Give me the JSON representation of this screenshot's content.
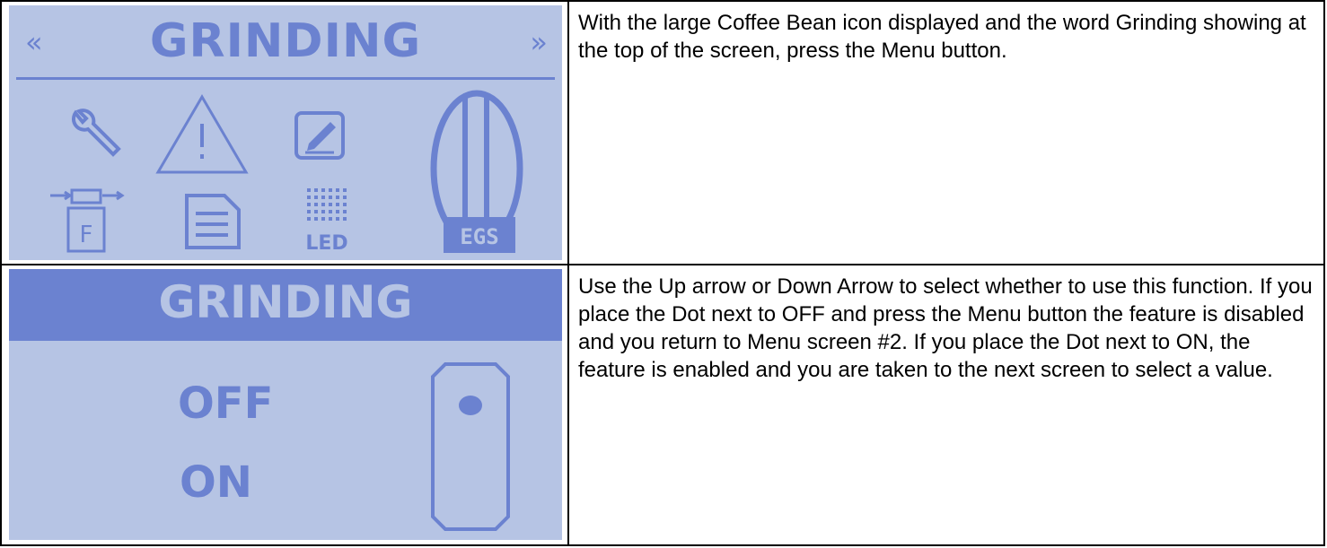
{
  "rows": [
    {
      "screen": {
        "title": "GRINDING",
        "nav_left": "«",
        "nav_right": "»",
        "icons": [
          "wrench-icon",
          "warning-icon",
          "edit-icon",
          "coffee-bean-icon",
          "filter-icon",
          "document-icon",
          "led-icon",
          "egs-icon"
        ],
        "led_label": "LED",
        "egs_label": "EGS",
        "filter_label": "F"
      },
      "text": "With the large Coffee Bean icon displayed and the word Grinding showing at the top of the screen, press the Menu button."
    },
    {
      "screen": {
        "title": "GRINDING",
        "options": [
          "OFF",
          "ON"
        ],
        "selected": "OFF",
        "icons": [
          "toggle-selector-icon"
        ]
      },
      "text": "Use the Up arrow or Down Arrow to select whether to use this function.  If you place the Dot next to OFF and press the Menu button the feature is disabled and you return to Menu screen #2. If you place the Dot next to ON, the feature is enabled and you are taken to the next screen to select a value."
    }
  ],
  "colors": {
    "lcd_background": "#b6c4e4",
    "lcd_foreground": "#6b82d0"
  }
}
